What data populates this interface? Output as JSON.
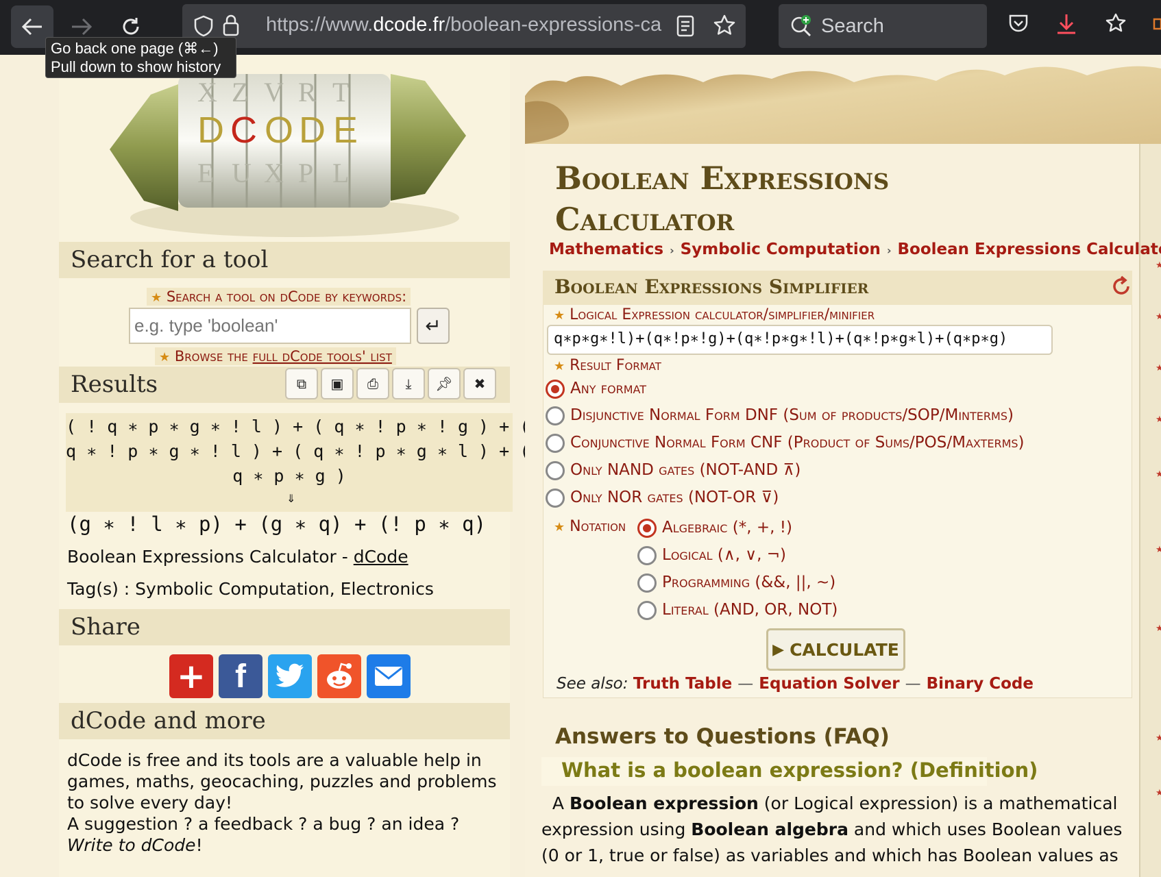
{
  "browser": {
    "url_prefix": "https://www.",
    "url_domain": "dcode.fr",
    "url_path": "/boolean-expressions-ca",
    "search_label": "Search",
    "tooltip_line1": "Go back one page (⌘←)",
    "tooltip_line2": "Pull down to show history"
  },
  "left": {
    "search_heading": "Search for a tool",
    "search_label": "Search a tool on dCode by keywords:",
    "search_placeholder": "e.g. type 'boolean'",
    "browse_prefix": "Browse the ",
    "browse_link": "full dCode tools' list",
    "results_heading": "Results",
    "result_input_lines": [
      "( ! q ∗ p ∗ g ∗ ! l ) + ( q ∗ ! p ∗ ! g ) + (",
      "q ∗ ! p ∗ g ∗ ! l ) + ( q ∗ ! p ∗ g ∗ l ) + (",
      "q ∗ p ∗ g )"
    ],
    "result_arrow": "⇓",
    "result_output": "(g ∗ ! l ∗ p) + (g ∗ q) + (! p ∗ q)",
    "cite_prefix": "Boolean Expressions Calculator - ",
    "cite_link": "dCode",
    "tags": "Tag(s) : Symbolic Computation, Electronics",
    "share_heading": "Share",
    "more_heading": "dCode and more",
    "more_text_1": "dCode is free and its tools are a valuable help in games, maths, geocaching, puzzles and problems to solve every day!",
    "more_text_2a": "A suggestion ? a feedback ? a bug ? an idea ? ",
    "more_text_2b": "Write to dCode",
    "more_text_2c": "!"
  },
  "right": {
    "title_line1": "Boolean Expressions",
    "title_line2": "Calculator",
    "breadcrumb": [
      "Mathematics",
      "Symbolic Computation",
      "Boolean Expressions Calculator"
    ],
    "tool_heading": "Boolean Expressions Simplifier",
    "expr_label": "Logical Expression calculator/simplifier/minifier",
    "expr_value": "q∗p∗g∗!l)+(q∗!p∗!g)+(q∗!p∗g∗!l)+(q∗!p∗g∗l)+(q∗p∗g)",
    "format_label": "Result Format",
    "formats": [
      "Any format",
      "Disjunctive Normal Form DNF (Sum of products/SOP/Minterms)",
      "Conjunctive Normal Form CNF (Product of Sums/POS/Maxterms)",
      "Only NAND gates (NOT-AND ⊼)",
      "Only NOR gates (NOT-OR ⊽)"
    ],
    "format_selected": "Any format",
    "notation_label": "Notation",
    "notations": [
      "Algebraic (*, +, !)",
      "Logical (∧, ∨, ¬)",
      "Programming (&&, ||, ~)",
      "Literal (AND, OR, NOT)"
    ],
    "notation_selected": "Algebraic (*, +, !)",
    "calc_label": "CALCULATE",
    "see_also_label": "See also:",
    "see_also": [
      "Truth Table",
      "Equation Solver",
      "Binary Code"
    ],
    "faq_heading": "Answers to Questions (FAQ)",
    "q1": "What is a boolean expression? (Definition)",
    "a1_b1": "Boolean expression",
    "a1_t1": " (or Logical expression) is a mathematical expression using ",
    "a1_b2": "Boolean algebra",
    "a1_t2": " and which uses Boolean values (0 or 1, true or false) as variables and which has Boolean values as",
    "a1_prefix": "A "
  },
  "colors": {
    "accent_red": "#a61b12",
    "title_brown": "#5e4c1a",
    "chrome_bg": "#202124"
  }
}
